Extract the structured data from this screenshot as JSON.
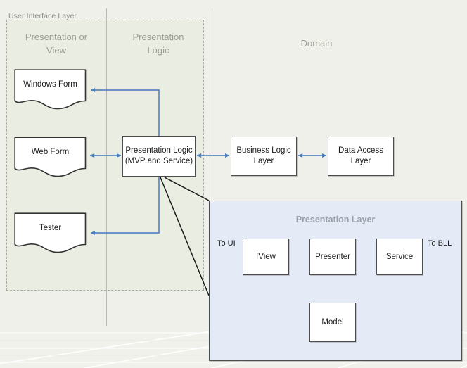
{
  "diagram": {
    "title": "User Interface Layer",
    "background_color": "#eff0e9",
    "group_fill_color": "#eaede1",
    "accent_arrow_color": "#4a7ebb",
    "panel_fill_color": "#e4ebf7",
    "box_border_color": "#4d4d4d"
  },
  "group": {
    "label": "User Interface Layer"
  },
  "columns": [
    {
      "id": "view",
      "title": "Presentation or\nView",
      "line1": "Presentation or",
      "line2": "View"
    },
    {
      "id": "logic",
      "title": "Presentation\nLogic",
      "line1": "Presentation",
      "line2": "Logic"
    },
    {
      "id": "domain",
      "title": "Domain",
      "line1": "Domain",
      "line2": ""
    }
  ],
  "documents": [
    {
      "id": "windows-form",
      "label": "Windows Form"
    },
    {
      "id": "web-form",
      "label": "Web Form"
    },
    {
      "id": "tester",
      "label": "Tester"
    }
  ],
  "boxes": {
    "presentation_logic": {
      "line1": "Presentation Logic",
      "line2": "(MVP and Service)"
    },
    "business_logic": {
      "line1": "Business Logic",
      "line2": "Layer"
    },
    "data_access": {
      "line1": "Data Access",
      "line2": "Layer"
    }
  },
  "presentation_layer": {
    "title": "Presentation Layer",
    "left_edge_label": "To UI",
    "right_edge_label": "To BLL",
    "nodes": [
      {
        "id": "iview",
        "label": "IView"
      },
      {
        "id": "presenter",
        "label": "Presenter"
      },
      {
        "id": "service",
        "label": "Service"
      },
      {
        "id": "model",
        "label": "Model"
      }
    ]
  }
}
